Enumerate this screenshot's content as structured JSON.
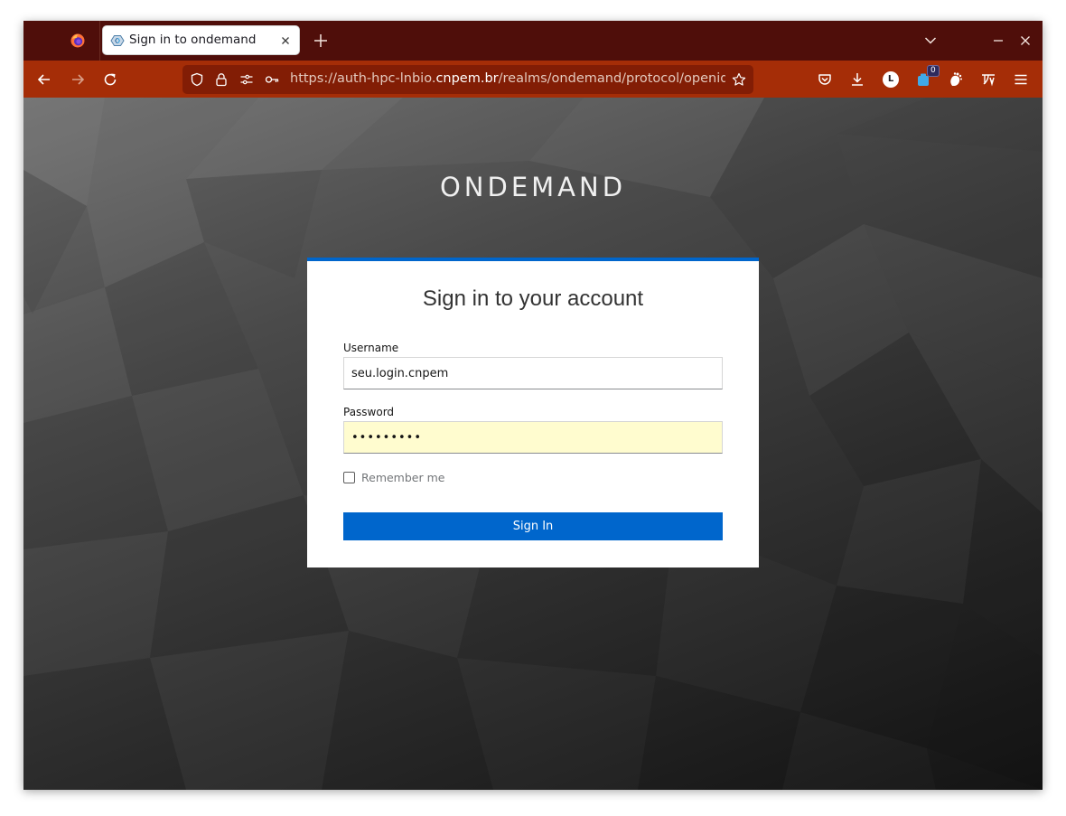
{
  "browser": {
    "tab": {
      "title": "Sign in to ondemand"
    },
    "url": {
      "prefix": "https://auth-hpc-lnbio.",
      "host": "cnpem.br",
      "path": "/realms/ondemand/protocol/openid-conn"
    },
    "toolbar": {
      "account_initial": "L",
      "extension_badge": "0"
    },
    "colors": {
      "tabstrip": "#4f0e0a",
      "toolbar": "#a52d07",
      "urlbar": "#821d05"
    }
  },
  "page": {
    "realm_title": "ONDEMAND",
    "card_title": "Sign in to your account",
    "username": {
      "label": "Username",
      "value": "seu.login.cnpem"
    },
    "password": {
      "label": "Password",
      "value": "•••••••••"
    },
    "remember_me": {
      "label": "Remember me",
      "checked": false
    },
    "submit_label": "Sign In",
    "colors": {
      "accent": "#0066cc",
      "autofill_bg": "#fffccf"
    }
  }
}
